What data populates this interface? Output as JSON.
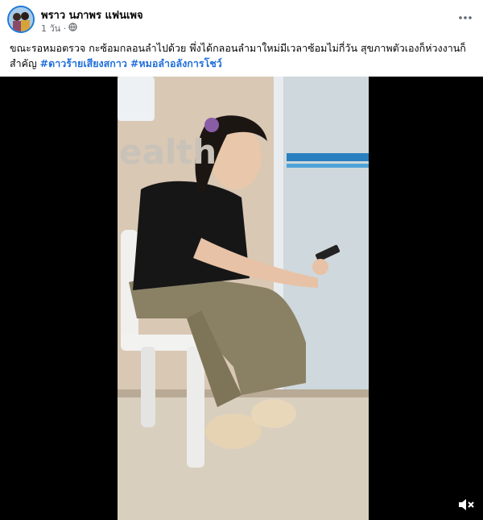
{
  "post": {
    "author_name": "พราว นภาพร แฟนเพจ",
    "time_ago": "1 วัน ·",
    "privacy_icon": "globe-icon",
    "more_icon": "more-options-icon",
    "caption_text": "ขณะรอหมอตรวจ กะซ้อมกลอนลำไปด้วย  พึ่งได้กลอนลำมาใหม่มีเวลาซ้อมไม่กี่วัน สุขภาพตัวเองก็ห่วงงานก็สำคัญ ",
    "hashtags": [
      "#ดาวร้ายเสียงสกาว",
      "#หมอลำอลังการโชว์"
    ]
  },
  "video": {
    "mute_icon": "speaker-muted-icon",
    "wall_sign_text": "ealth"
  }
}
